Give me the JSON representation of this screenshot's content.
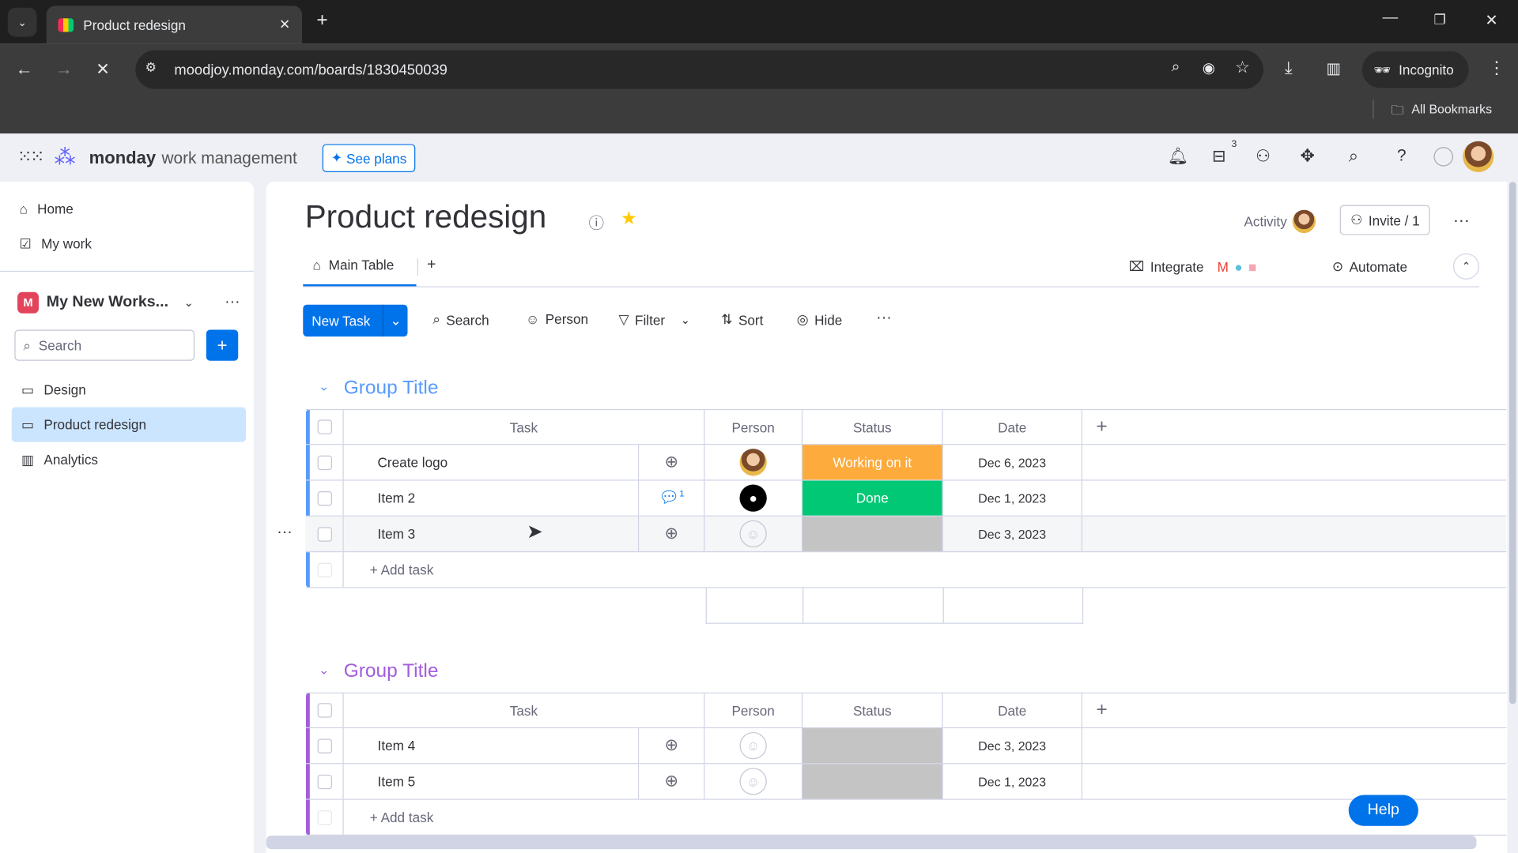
{
  "browser": {
    "tab_title": "Product redesign",
    "url": "moodjoy.monday.com/boards/1830450039",
    "profile": "Incognito",
    "bookmarks": "All Bookmarks"
  },
  "app": {
    "brand": "monday",
    "product": "work management",
    "see_plans": "See plans",
    "inbox_badge": "3"
  },
  "sidebar": {
    "nav": [
      {
        "label": "Home",
        "icon": "home-icon"
      },
      {
        "label": "My work",
        "icon": "calendar-check-icon"
      }
    ],
    "workspace": "My New Works...",
    "workspace_initial": "M",
    "search_placeholder": "Search",
    "boards": [
      {
        "label": "Design",
        "active": false
      },
      {
        "label": "Product redesign",
        "active": true
      },
      {
        "label": "Analytics",
        "active": false
      }
    ]
  },
  "board": {
    "title": "Product redesign",
    "activity": "Activity",
    "invite": "Invite / 1",
    "view_tab": "Main Table",
    "integrate": "Integrate",
    "automate": "Automate",
    "toolbar": {
      "new_task": "New Task",
      "search": "Search",
      "person": "Person",
      "filter": "Filter",
      "sort": "Sort",
      "hide": "Hide"
    }
  },
  "columns": {
    "task": "Task",
    "person": "Person",
    "status": "Status",
    "date": "Date"
  },
  "groups": [
    {
      "title": "Group Title",
      "color": "#579bfc",
      "add_task": "+ Add task",
      "items": [
        {
          "name": "Create logo",
          "person": "photo",
          "status": "Working on it",
          "status_color": "#fdab3d",
          "date": "Dec 6, 2023",
          "updates": 0
        },
        {
          "name": "Item 2",
          "person": "owner",
          "status": "Done",
          "status_color": "#00c875",
          "date": "Dec 1, 2023",
          "updates": 1
        },
        {
          "name": "Item 3",
          "person": "empty",
          "status": "",
          "status_color": "#c4c4c4",
          "date": "Dec 3, 2023",
          "updates": 0
        }
      ]
    },
    {
      "title": "Group Title",
      "color": "#a25ddc",
      "add_task": "+ Add task",
      "items": [
        {
          "name": "Item 4",
          "person": "empty",
          "status": "",
          "status_color": "#c4c4c4",
          "date": "Dec 3, 2023",
          "updates": 0
        },
        {
          "name": "Item 5",
          "person": "empty",
          "status": "",
          "status_color": "#c4c4c4",
          "date": "Dec 1, 2023",
          "updates": 0
        }
      ]
    }
  ],
  "help": "Help"
}
